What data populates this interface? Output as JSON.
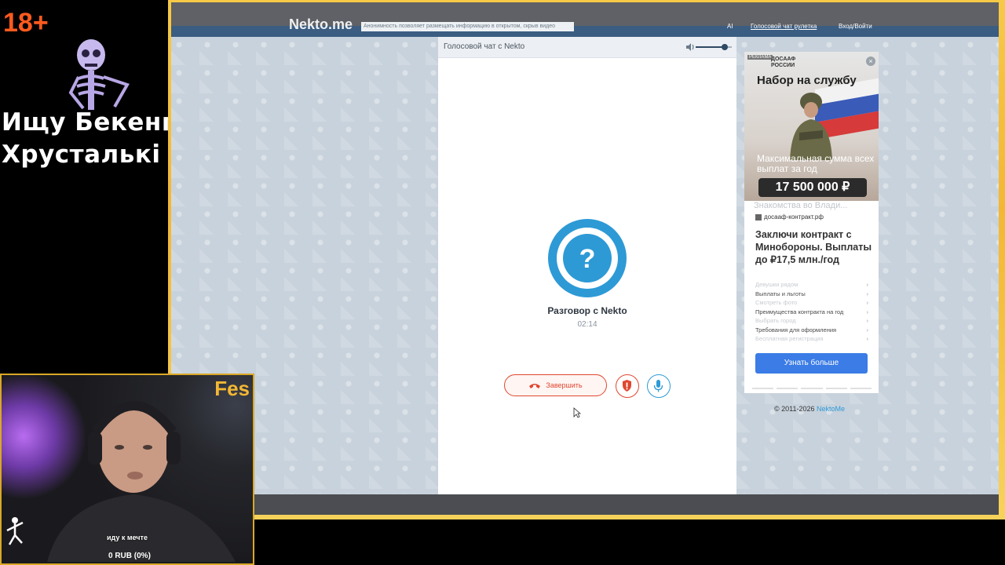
{
  "overlay": {
    "age_badge": "18+",
    "title_line1": "Ищу Бекенг",
    "title_line2": "Хрусталькі",
    "streamer_name": "Fes",
    "donation_goal_text": "иду к мечте",
    "donation_amount": "0 RUB (0%)"
  },
  "site": {
    "logo": "Nekto.me",
    "notice": "Анонимность позволяет размещать информацию в открытом, скрыв видео",
    "nav_ai": "AI",
    "nav_voice": "Голосовой чат рулетка",
    "nav_login": "Вход/Войти"
  },
  "chat": {
    "header_title": "Голосовой чат с Nekto",
    "partner_name": "Разговор с Nekto",
    "timer": "02:14",
    "end_call_label": "Завершить",
    "volume_level": 0.8
  },
  "ad": {
    "label": "РЕКЛАМА",
    "brand": "ДОСААФ РОССИИ",
    "headline": "Набор на службу",
    "subline": "Максимальная сумма всех выплат за год",
    "amount": "17 500 000 ₽",
    "ghost_text": "Знакомства во Влади...",
    "domain": "досааф-контракт.рф",
    "title": "Заключи контракт с Минобороны. Выплаты до ₽17,5 млн./год",
    "links": [
      {
        "text": "Девушки рядом",
        "ghost": true
      },
      {
        "text": "Выплаты и льготы",
        "ghost": false
      },
      {
        "text": "Смотреть фото",
        "ghost": true
      },
      {
        "text": "Преимущества контракта на год",
        "ghost": false
      },
      {
        "text": "Выбрать город",
        "ghost": true
      },
      {
        "text": "Требования для оформления",
        "ghost": false
      },
      {
        "text": "Бесплатная регистрация",
        "ghost": true
      }
    ],
    "cta": "Узнать больше"
  },
  "footer": {
    "copyright": "© 2011-2026",
    "copyright_link": "NektoMe"
  },
  "colors": {
    "accent_blue": "#2d9ad6",
    "end_call_red": "#e0472f",
    "frame_gold": "#f3b733",
    "age_badge": "#ff5a1e"
  },
  "icons": [
    "question-avatar-icon",
    "hangup-phone-icon",
    "report-shield-icon",
    "microphone-icon",
    "volume-icon",
    "close-icon",
    "cursor-icon"
  ]
}
